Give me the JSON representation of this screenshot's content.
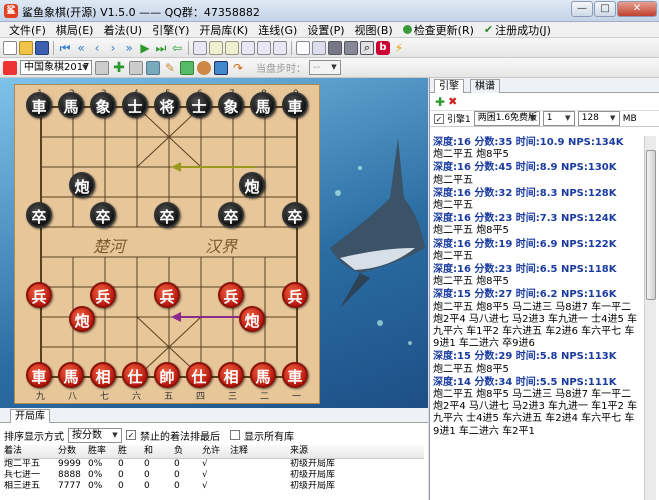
{
  "window": {
    "title": "鲨鱼象棋(开源) V1.5.0 —— QQ群：47358882"
  },
  "menu": [
    {
      "label": "文件(F)"
    },
    {
      "label": "棋局(E)"
    },
    {
      "label": "着法(U)"
    },
    {
      "label": "引擎(Y)"
    },
    {
      "label": "开局库(K)"
    },
    {
      "label": "连线(G)"
    },
    {
      "label": "设置(P)"
    },
    {
      "label": "视图(B)"
    },
    {
      "label": "检查更新(R)"
    },
    {
      "label": "注册成功(J)"
    }
  ],
  "toolbar2": {
    "ruleset": "中国象棋2017",
    "step_label": "当盘步时：",
    "step_value": "--"
  },
  "board": {
    "top_numbers": [
      "1",
      "2",
      "3",
      "4",
      "5",
      "6",
      "7",
      "8",
      "9"
    ],
    "bottom_numbers": [
      "九",
      "八",
      "七",
      "六",
      "五",
      "四",
      "三",
      "二",
      "一"
    ],
    "river_left": "楚河",
    "river_right": "汉界",
    "black_pieces": [
      "車",
      "馬",
      "象",
      "士",
      "将",
      "士",
      "象",
      "馬",
      "車",
      "炮",
      "炮",
      "卒",
      "卒",
      "卒",
      "卒",
      "卒"
    ],
    "red_pieces": [
      "兵",
      "兵",
      "兵",
      "兵",
      "兵",
      "炮",
      "炮",
      "車",
      "馬",
      "相",
      "仕",
      "帥",
      "仕",
      "相",
      "馬",
      "車"
    ]
  },
  "bottom": {
    "tab": "开局库",
    "sort_label": "排序显示方式",
    "sort_value": "按分数",
    "opt1": "禁止的着法排最后",
    "opt2": "显示所有库",
    "columns": [
      "着法",
      "分数",
      "胜率",
      "胜",
      "和",
      "负",
      "允许",
      "注释",
      "来源"
    ],
    "rows": [
      [
        "炮二平五",
        "9999",
        "0%",
        "0",
        "0",
        "0",
        "√",
        "",
        "初级开局库"
      ],
      [
        "兵七进一",
        "8888",
        "0%",
        "0",
        "0",
        "0",
        "√",
        "",
        "初级开局库"
      ],
      [
        "相三进五",
        "7777",
        "0%",
        "0",
        "0",
        "0",
        "√",
        "",
        "初级开局库"
      ]
    ]
  },
  "right": {
    "tabs": [
      "引擎",
      "棋谱"
    ],
    "engine_label": "引擎1",
    "engine_name": "两困1.6免费版",
    "thread": "1",
    "hash": "128",
    "unit": "MB",
    "lines": [
      {
        "depth": "深度:16 分数:35 时间:10.9 NPS:134K",
        "moves": "炮二平五 炮8平5"
      },
      {
        "depth": "深度:16 分数:45 时间:8.9 NPS:130K",
        "moves": "炮二平五"
      },
      {
        "depth": "深度:16 分数:32 时间:8.3 NPS:128K",
        "moves": "炮二平五"
      },
      {
        "depth": "深度:16 分数:23 时间:7.3 NPS:124K",
        "moves": "炮二平五 炮8平5"
      },
      {
        "depth": "深度:16 分数:19 时间:6.9 NPS:122K",
        "moves": "炮二平五"
      },
      {
        "depth": "深度:16 分数:23 时间:6.5 NPS:118K",
        "moves": "炮二平五 炮8平5"
      },
      {
        "depth": "深度:15 分数:27 时间:6.2 NPS:116K",
        "moves": "炮二平五 炮8平5 马二进三 马8进7 车一平二 炮2平4 马八进七 马2进3 车九进一 士4进5 车九平六 车1平2 车六进五 车2进6 车六平七 车9进1 车二进六 卒9进6"
      },
      {
        "depth": "深度:15 分数:29 时间:5.8 NPS:113K",
        "moves": "炮二平五 炮8平5"
      },
      {
        "depth": "深度:14 分数:34 时间:5.5 NPS:111K",
        "moves": "炮二平五 炮8平5 马二进三 马8进7 车一平二 炮2平4 马八进七 马2进3 车九进一 车1平2 车九平六 士4进5 车六进五 车2进4 车六平七 车9进1 车二进六 车2平1"
      }
    ]
  }
}
